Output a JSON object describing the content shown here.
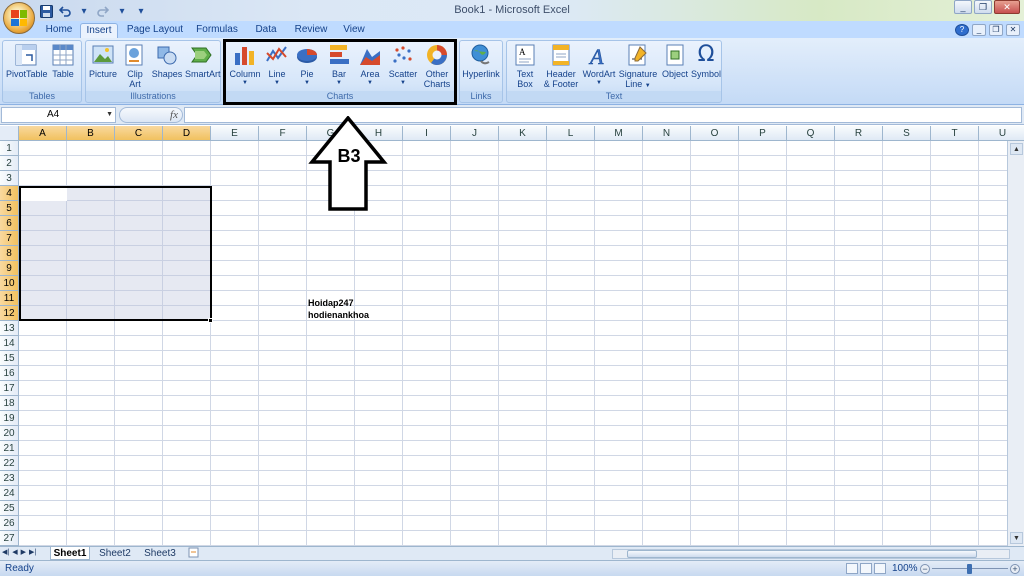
{
  "window": {
    "title": "Book1 - Microsoft Excel"
  },
  "tabs": [
    "Home",
    "Insert",
    "Page Layout",
    "Formulas",
    "Data",
    "Review",
    "View"
  ],
  "active_tab": "Insert",
  "ribbon": {
    "groups": {
      "tables": "Tables",
      "illustrations": "Illustrations",
      "charts": "Charts",
      "links": "Links",
      "text": "Text"
    },
    "buttons": {
      "pivottable": "PivotTable",
      "table": "Table",
      "picture": "Picture",
      "clipart_1": "Clip",
      "clipart_2": "Art",
      "shapes": "Shapes",
      "smartart": "SmartArt",
      "column": "Column",
      "line": "Line",
      "pie": "Pie",
      "bar": "Bar",
      "area": "Area",
      "scatter": "Scatter",
      "other_1": "Other",
      "other_2": "Charts",
      "hyperlink": "Hyperlink",
      "textbox_1": "Text",
      "textbox_2": "Box",
      "header_1": "Header",
      "header_2": "& Footer",
      "wordart": "WordArt",
      "signature_1": "Signature",
      "signature_2": "Line",
      "object": "Object",
      "symbol": "Symbol"
    }
  },
  "formula_bar": {
    "name_box": "A4",
    "fx": "fx",
    "value": ""
  },
  "columns": [
    "A",
    "B",
    "C",
    "D",
    "E",
    "F",
    "G",
    "H",
    "I",
    "J",
    "K",
    "L",
    "M",
    "N",
    "O",
    "P",
    "Q",
    "R",
    "S",
    "T",
    "U"
  ],
  "rows": [
    "1",
    "2",
    "3",
    "4",
    "5",
    "6",
    "7",
    "8",
    "9",
    "10",
    "11",
    "12",
    "13",
    "14",
    "15",
    "16",
    "17",
    "18",
    "19",
    "20",
    "21",
    "22",
    "23",
    "24",
    "25",
    "26",
    "27"
  ],
  "selected_columns": [
    "A",
    "B",
    "C",
    "D"
  ],
  "selected_rows": [
    "4",
    "5",
    "6",
    "7",
    "8",
    "9",
    "10",
    "11",
    "12"
  ],
  "cells": {
    "text1": "Hoidap247",
    "text2": "hodienankhoa"
  },
  "annotation": {
    "label": "B3"
  },
  "sheets": [
    "Sheet1",
    "Sheet2",
    "Sheet3"
  ],
  "active_sheet": "Sheet1",
  "status": {
    "text": "Ready",
    "zoom": "100%"
  },
  "colors": {
    "ribbon": "#dbe7f5",
    "accent": "#15428b",
    "selection": "#f1c15f"
  }
}
